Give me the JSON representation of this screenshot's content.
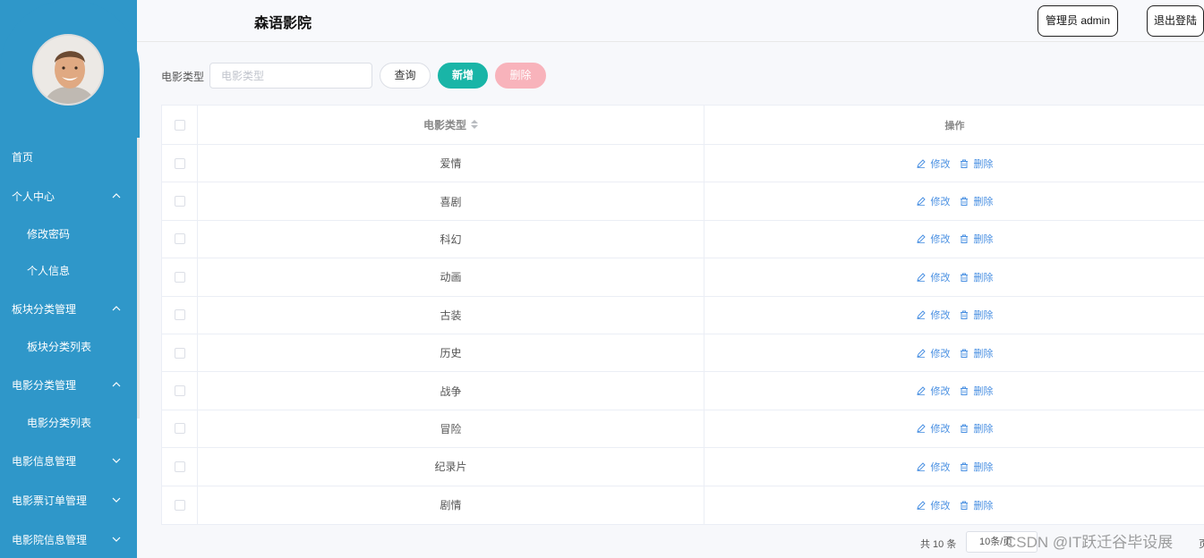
{
  "header": {
    "title": "森语影院",
    "admin_label": "管理员 admin",
    "logout_label": "退出登陆"
  },
  "sidebar": {
    "items": [
      {
        "label": "首页"
      },
      {
        "label": "个人中心"
      },
      {
        "label": "修改密码"
      },
      {
        "label": "个人信息"
      },
      {
        "label": "板块分类管理"
      },
      {
        "label": "板块分类列表"
      },
      {
        "label": "电影分类管理"
      },
      {
        "label": "电影分类列表"
      },
      {
        "label": "电影信息管理"
      },
      {
        "label": "电影票订单管理"
      },
      {
        "label": "电影院信息管理"
      }
    ]
  },
  "filter": {
    "label": "电影类型",
    "placeholder": "电影类型",
    "query_label": "查询",
    "add_label": "新增",
    "delete_label": "删除"
  },
  "table": {
    "headers": {
      "type": "电影类型",
      "actions": "操作"
    },
    "edit_label": "修改",
    "delete_label": "删除",
    "rows": [
      {
        "type": "爱情"
      },
      {
        "type": "喜剧"
      },
      {
        "type": "科幻"
      },
      {
        "type": "动画"
      },
      {
        "type": "古装"
      },
      {
        "type": "历史"
      },
      {
        "type": "战争"
      },
      {
        "type": "冒险"
      },
      {
        "type": "纪录片"
      },
      {
        "type": "剧情"
      }
    ]
  },
  "pagination": {
    "total": "共 10 条",
    "page_size": "10条/页",
    "suffix": "页"
  },
  "watermark": "CSDN @IT跃迁谷毕设展",
  "colors": {
    "sidebar": "#2f97c9",
    "add_button": "#19b5a7",
    "delete_button": "#f8b3bb",
    "link": "#4a90e2"
  }
}
